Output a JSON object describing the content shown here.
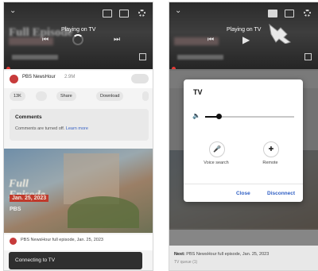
{
  "left": {
    "video": {
      "title_overlay": "Full Episode",
      "status": "Playing on TV"
    },
    "channel": {
      "name": "PBS NewsHour",
      "subscribers": "2.9M"
    },
    "actions": [
      "13K",
      "Share",
      "Download"
    ],
    "comments": {
      "title": "Comments",
      "text": "Comments are turned off.",
      "link": "Learn more"
    },
    "thumbnail": {
      "title": "Full Episode",
      "date": "Jan. 25, 2023",
      "logo": "PBS"
    },
    "next_item": "PBS NewsHour full episode, Jan. 25, 2023",
    "toast": "Connecting to TV"
  },
  "right": {
    "video": {
      "status": "Playing on TV"
    },
    "dialog": {
      "title": "TV",
      "volume": 0.15,
      "voice_label": "Voice search",
      "remote_label": "Remote",
      "close_label": "Close",
      "disconnect_label": "Disconnect"
    },
    "bottom": {
      "next_prefix": "Next:",
      "next_title": "PBS NewsHour full episode, Jan. 25, 2023",
      "sub": "TV queue (1)"
    }
  },
  "colors": {
    "accent_blue": "#2f5fc4",
    "progress_red": "#e53935",
    "dialog_bg": "#ffffff"
  },
  "icons": [
    "chevron-down-icon",
    "cast-icon",
    "captions-icon",
    "gear-icon",
    "skip-previous-icon",
    "skip-next-icon",
    "play-icon",
    "fullscreen-icon",
    "volume-icon",
    "mic-icon",
    "remote-dpad-icon",
    "hand-pointer-icon"
  ]
}
